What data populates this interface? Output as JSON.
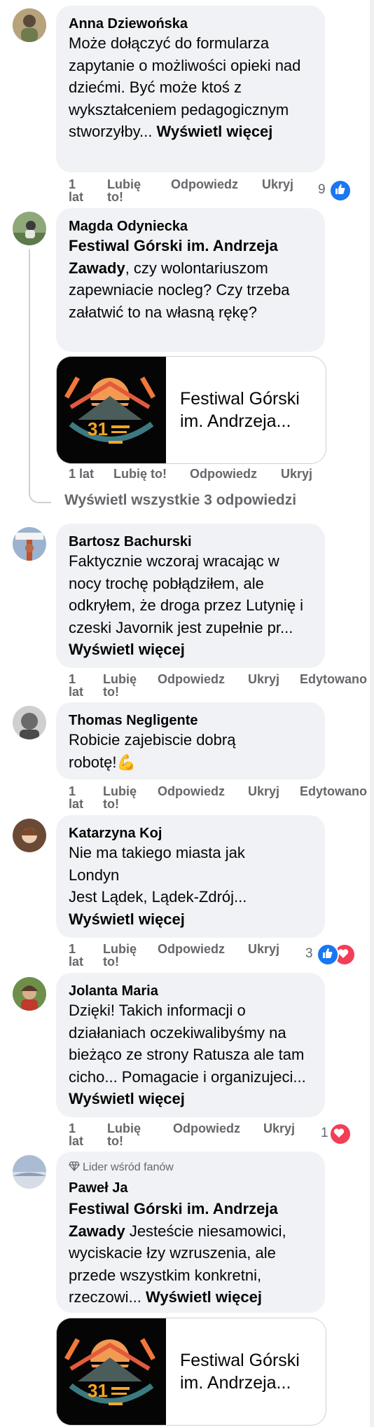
{
  "comments": [
    {
      "author": "Anna Dziewońska",
      "text": "Może dołączyć do formularza zapytanie o możliwości opieki nad dziećmi. Być może ktoś z wykształceniem pedagogicznym stworzyłby...",
      "see_more": "Wyświetl więcej",
      "meta": {
        "time": "1 lat",
        "like": "Lubię to!",
        "reply": "Odpowiedz",
        "hide": "Ukryj"
      },
      "reaction_count": "9",
      "reaction_icons": [
        "like-icon"
      ]
    },
    {
      "author": "Magda Odyniecka",
      "mention": "Festiwal Górski im. Andrzeja Zawady",
      "text": ", czy wolontariuszom zapewniacie nocleg? Czy trzeba załatwić to na własną rękę?",
      "link_card_title": "Festiwal Górski im. Andrzeja...",
      "meta": {
        "time": "1 lat",
        "like": "Lubię to!",
        "reply": "Odpowiedz",
        "hide": "Ukryj"
      },
      "see_all_replies": "Wyświetl wszystkie 3 odpowiedzi"
    },
    {
      "author": "Bartosz Bachurski",
      "text": "Faktycznie wczoraj wracając w nocy trochę pobłądziłem, ale odkryłem, że droga przez Lutynię i czeski Javornik jest zupełnie pr...",
      "see_more": "Wyświetl więcej",
      "meta": {
        "time": "1 lat",
        "like": "Lubię to!",
        "reply": "Odpowiedz",
        "hide": "Ukryj",
        "edited": "Edytowano"
      }
    },
    {
      "author": "Thomas Negligente",
      "text": "Robicie zajebiscie dobrą robotę!",
      "emoji": "💪",
      "meta": {
        "time": "1 lat",
        "like": "Lubię to!",
        "reply": "Odpowiedz",
        "hide": "Ukryj",
        "edited": "Edytowano"
      }
    },
    {
      "author": "Katarzyna Koj",
      "text_line1": "Nie ma takiego miasta jak Londyn",
      "text_line2": "Jest Lądek, Lądek-Zdrój...",
      "see_more": "Wyświetl więcej",
      "meta": {
        "time": "1 lat",
        "like": "Lubię to!",
        "reply": "Odpowiedz",
        "hide": "Ukryj"
      },
      "reaction_count": "3",
      "reaction_icons": [
        "like-icon",
        "love-icon"
      ]
    },
    {
      "author": "Jolanta Maria",
      "text": "Dzięki! Takich informacji o działaniach oczekiwalibyśmy na bieżąco ze strony Ratusza ale tam cicho... Pomagacie i organizujeci...",
      "see_more": "Wyświetl więcej",
      "meta": {
        "time": "1 lat",
        "like": "Lubię to!",
        "reply": "Odpowiedz",
        "hide": "Ukryj"
      },
      "reaction_count": "1",
      "reaction_icons": [
        "love-icon"
      ]
    },
    {
      "badge": "Lider wśród fanów",
      "author": "Paweł Ja",
      "mention": "Festiwal Górski im. Andrzeja Zawady",
      "text": " Jesteście niesamowici, wyciskacie łzy wzruszenia, ale przede wszystkim konkretni, rzeczowi...",
      "see_more": "Wyświetl więcej",
      "link_card_title": "Festiwal Górski im. Andrzeja..."
    }
  ],
  "colors": {
    "like": "#1877f2",
    "love": "#f33e58",
    "bubble": "#f0f2f5",
    "meta": "#65676b"
  }
}
